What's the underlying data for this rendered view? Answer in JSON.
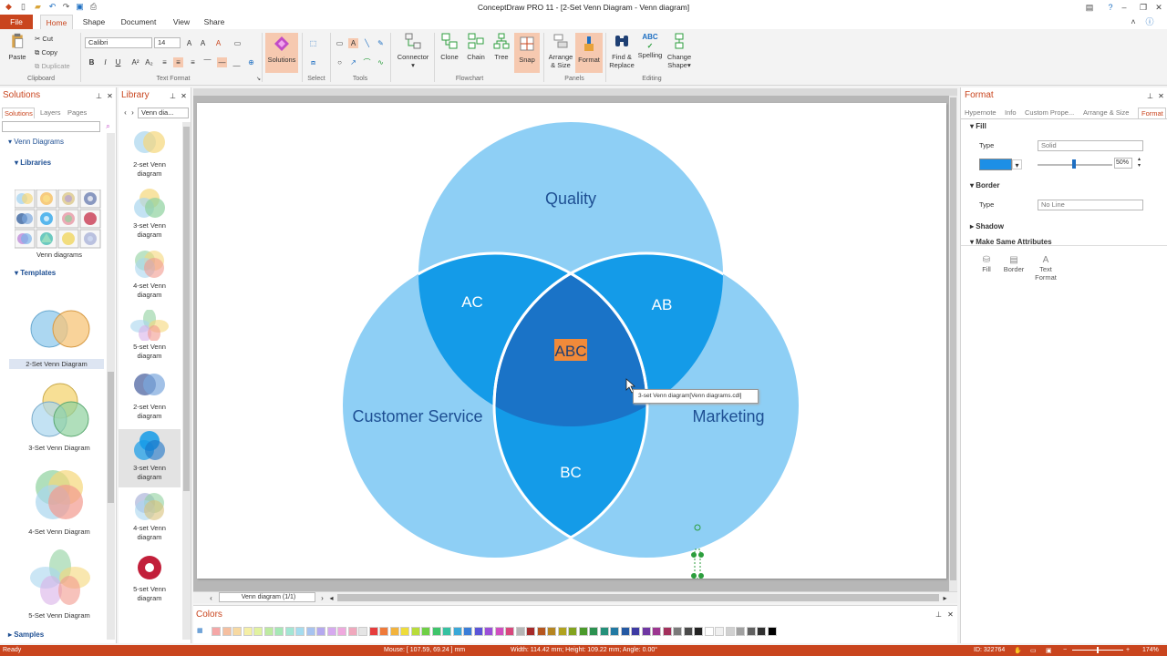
{
  "app": {
    "title": "ConceptDraw PRO 11 - [2-Set Venn Diagram - Venn diagram]"
  },
  "tabs": [
    "File",
    "Home",
    "Shape",
    "Document",
    "View",
    "Share"
  ],
  "clipboard": {
    "paste": "Paste",
    "cut": "Cut",
    "copy": "Copy",
    "duplicate": "Duplicate",
    "group": "Clipboard"
  },
  "text_format": {
    "font": "Calibri",
    "size": "14",
    "group": "Text Format"
  },
  "ribbon": {
    "solutions": "Solutions",
    "select_group": "Select",
    "tools_group": "Tools",
    "connector": "Connector",
    "clone": "Clone",
    "chain": "Chain",
    "tree": "Tree",
    "snap": "Snap",
    "flowchart_group": "Flowchart",
    "arrange_1": "Arrange",
    "arrange_2": "& Size",
    "format": "Format",
    "panels_group": "Panels",
    "find_1": "Find &",
    "find_2": "Replace",
    "spelling": "Spelling",
    "spelling_icon": "ABC",
    "change_1": "Change",
    "change_2": "Shape",
    "editing_group": "Editing"
  },
  "solutions_panel": {
    "title": "Solutions",
    "tabs": [
      "Solutions",
      "Layers",
      "Pages"
    ],
    "tree_venn": "Venn Diagrams",
    "libraries": "Libraries",
    "library_item": "Venn diagrams",
    "templates": "Templates",
    "template_items": [
      "2-Set Venn Diagram",
      "3-Set Venn Diagram",
      "4-Set Venn Diagram",
      "5-Set Venn Diagram"
    ],
    "samples": "Samples"
  },
  "library_panel": {
    "title": "Library",
    "dropdown": "Venn dia...",
    "items": [
      [
        "2-set Venn",
        "diagram"
      ],
      [
        "3-set Venn",
        "diagram"
      ],
      [
        "4-set Venn",
        "diagram"
      ],
      [
        "5-set Venn",
        "diagram"
      ],
      [
        "2-set Venn",
        "diagram"
      ],
      [
        "3-set Venn",
        "diagram"
      ],
      [
        "4-set Venn",
        "diagram"
      ],
      [
        "5-set Venn",
        "diagram"
      ]
    ]
  },
  "diagram": {
    "quality": "Quality",
    "customer": "Customer Service",
    "marketing": "Marketing",
    "ac": "AC",
    "ab": "AB",
    "bc": "BC",
    "abc": "ABC",
    "tooltip": "3-set Venn diagram[Venn diagrams.cdl]",
    "colors": {
      "outer": "#8ecff5",
      "pair": "#149be8",
      "center": "#1a73c7",
      "abc_highlight": "#f08a3a"
    }
  },
  "page_nav": {
    "label": "Venn diagram (1/1)"
  },
  "colors_panel": {
    "title": "Colors"
  },
  "format_panel": {
    "title": "Format",
    "tabs": [
      "Hypernote",
      "Info",
      "Custom Prope...",
      "Arrange & Size",
      "Format"
    ],
    "fill": "Fill",
    "type_label": "Type",
    "fill_type": "Solid",
    "fill_color": "#1d8fe6",
    "opacity": "50%",
    "border": "Border",
    "border_type": "No Line",
    "shadow": "Shadow",
    "make_same": "Make Same Attributes",
    "ms_fill": "Fill",
    "ms_border": "Border",
    "ms_text_1": "Text",
    "ms_text_2": "Format"
  },
  "status": {
    "ready": "Ready",
    "mouse": "Mouse: [ 107.59, 69.24 ] mm",
    "size": "Width: 114.42 mm;  Height: 109.22 mm;  Angle: 0.00°",
    "id": "ID: 322764",
    "zoom": "174%"
  }
}
